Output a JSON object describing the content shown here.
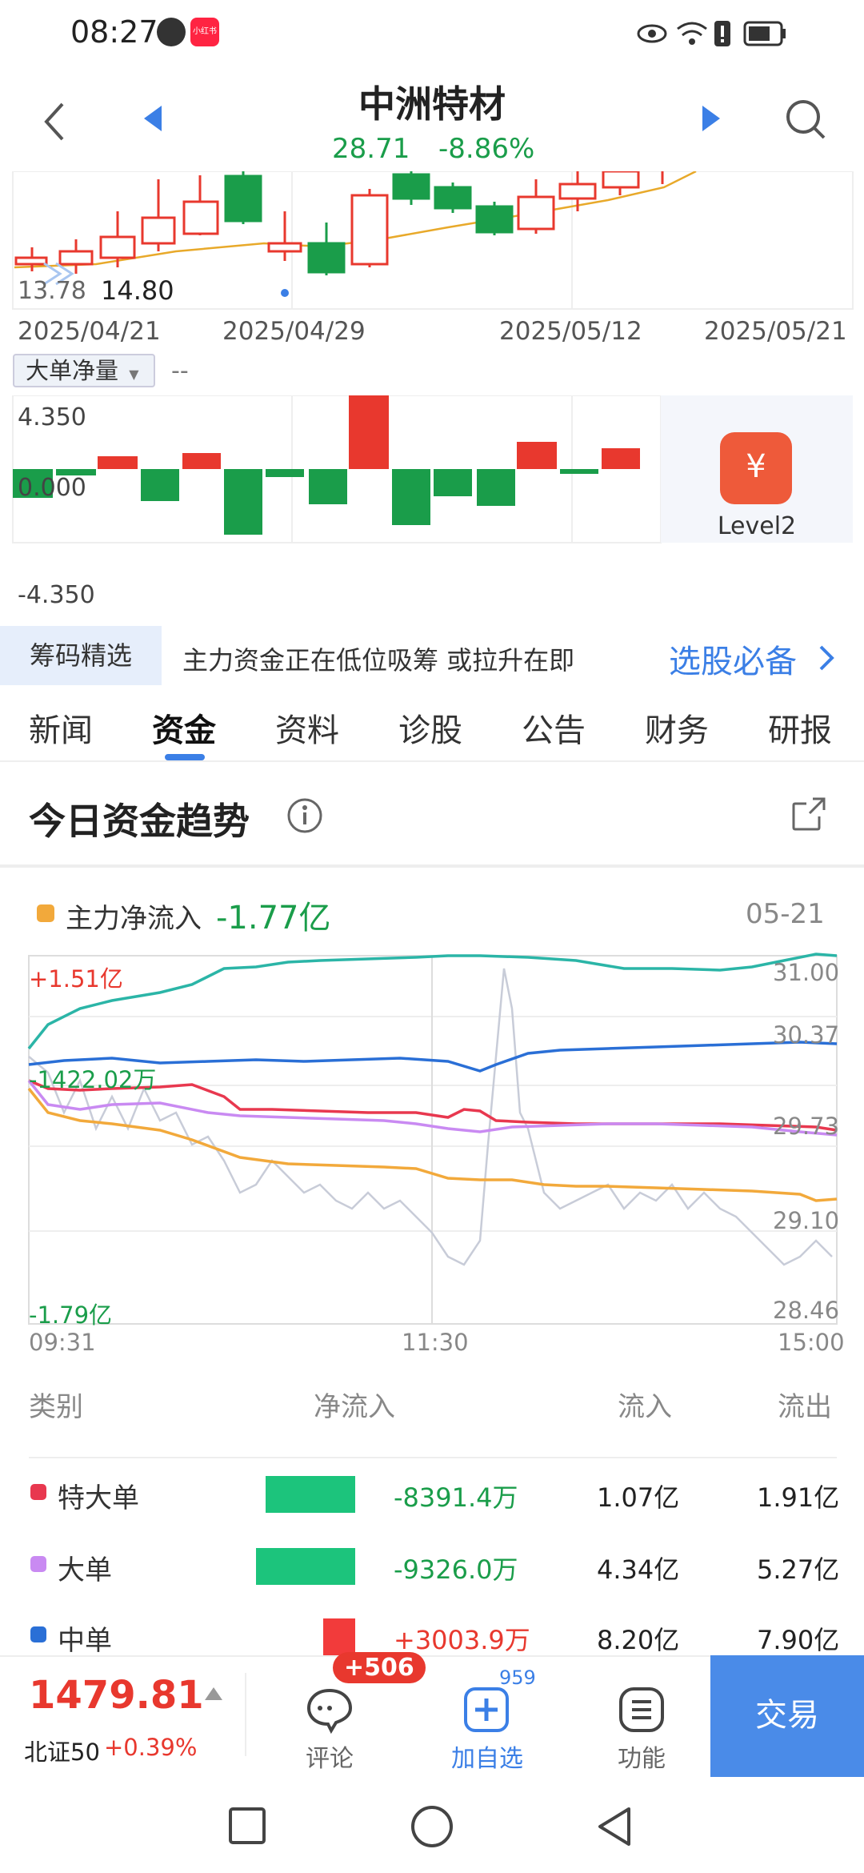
{
  "status": {
    "time": "08:27",
    "app_badge": "小红书"
  },
  "header": {
    "title": "中洲特材",
    "price": "28.71",
    "change": "-8.86%"
  },
  "kline": {
    "low_label_a": "13.78",
    "low_label_b": "14.80",
    "dates": [
      "2025/04/21",
      "2025/04/29",
      "2025/05/12",
      "2025/05/21"
    ],
    "indicator_select": "大单净量",
    "indicator_value": "--",
    "y_labels": [
      "4.350",
      "0.000",
      "-4.350"
    ],
    "level2_label": "Level2"
  },
  "banner": {
    "tag": "筹码精选",
    "text": "主力资金正在低位吸筹 或拉升在即",
    "link": "选股必备"
  },
  "tabs": [
    "新闻",
    "资金",
    "资料",
    "诊股",
    "公告",
    "财务",
    "研报"
  ],
  "active_tab": 1,
  "section_title": "今日资金趋势",
  "flow": {
    "legend_label": "主力净流入",
    "legend_value": "-1.77亿",
    "date": "05-21",
    "left_labels": [
      "+1.51亿",
      "-1422.02万",
      "-1.79亿"
    ],
    "right_labels": [
      "31.00",
      "30.37",
      "29.73",
      "29.10",
      "28.46"
    ],
    "time_labels": [
      "09:31",
      "11:30",
      "15:00"
    ]
  },
  "table": {
    "headers": [
      "类别",
      "净流入",
      "流入",
      "流出"
    ],
    "rows": [
      {
        "name": "特大单",
        "net": "-8391.4万",
        "in": "1.07亿",
        "out": "1.91亿",
        "color": "#e8384f"
      },
      {
        "name": "大单",
        "net": "-9326.0万",
        "in": "4.34亿",
        "out": "5.27亿",
        "color": "#c98af2"
      },
      {
        "name": "中单",
        "net": "+3003.9万",
        "in": "8.20亿",
        "out": "7.90亿",
        "color": "#2a6fd6"
      }
    ]
  },
  "bottom": {
    "index_value": "1479.81",
    "index_name": "北证50",
    "index_change": "+0.39%",
    "comment_label": "评论",
    "comment_badge": "+506",
    "add_label": "加自选",
    "add_count": "959",
    "func_label": "功能",
    "trade_label": "交易"
  },
  "colors": {
    "up": "#e8382e",
    "down": "#1a9d4a",
    "accent": "#4a8be8"
  }
}
